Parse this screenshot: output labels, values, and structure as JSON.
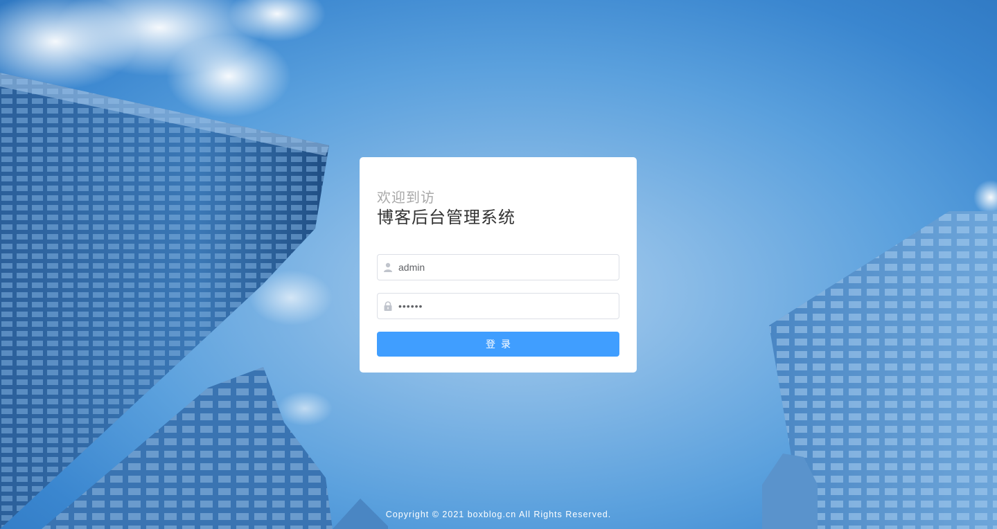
{
  "login": {
    "welcome": "欢迎到访",
    "title": "博客后台管理系统",
    "username_value": "admin",
    "password_value": "••••••",
    "submit_label": "登录"
  },
  "footer": {
    "copyright": "Copyright © 2021 boxblog.cn All Rights Reserved."
  },
  "colors": {
    "primary": "#409eff",
    "card_bg": "#ffffff",
    "title_text": "#333333",
    "welcome_text": "#a8a8a8"
  },
  "icons": {
    "username": "user-icon",
    "password": "lock-icon"
  }
}
